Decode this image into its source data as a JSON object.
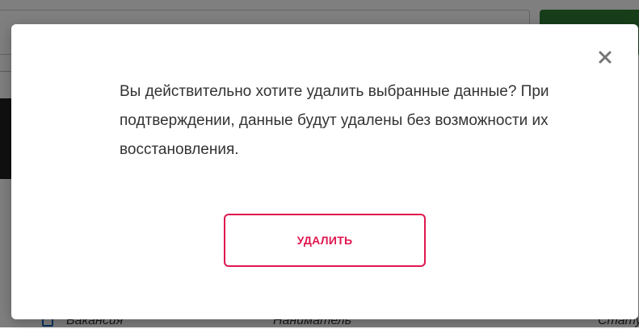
{
  "background": {
    "table_headers": [
      "Вакансия",
      "Наниматель",
      "Стату"
    ]
  },
  "modal": {
    "message": "Вы действительно хотите удалить выбранные данные? При подтверждении, данные будут удалены без возможности их восстановления.",
    "confirm_label": "УДАЛИТЬ",
    "close_icon": "close-icon"
  },
  "colors": {
    "accent_danger": "#e0174f",
    "overlay": "rgba(0,0,0,0.5)",
    "bg_green": "#2e7d32",
    "text": "#333333",
    "close_icon": "#757575"
  }
}
